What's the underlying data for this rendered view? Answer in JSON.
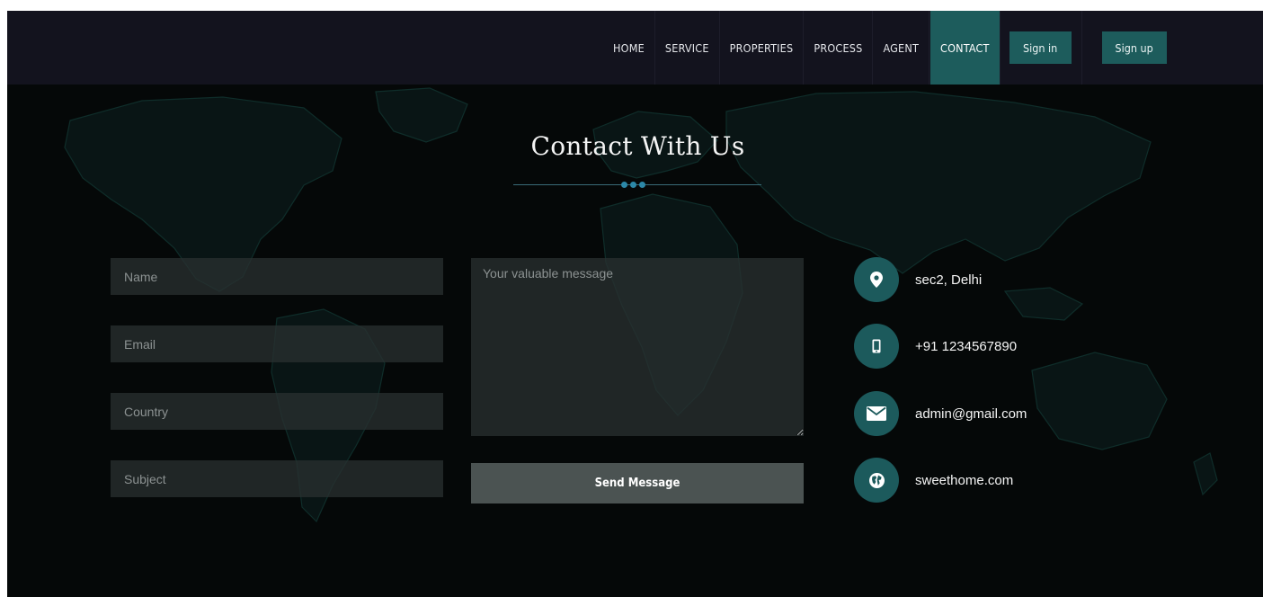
{
  "nav": {
    "items": [
      {
        "label": "HOME"
      },
      {
        "label": "SERVICE"
      },
      {
        "label": "PROPERTIES"
      },
      {
        "label": "PROCESS"
      },
      {
        "label": "AGENT"
      },
      {
        "label": "CONTACT",
        "active": true
      }
    ],
    "signin_label": "Sign in",
    "signup_label": "Sign up"
  },
  "section": {
    "title": "Contact With Us"
  },
  "form": {
    "name_placeholder": "Name",
    "email_placeholder": "Email",
    "country_placeholder": "Country",
    "subject_placeholder": "Subject",
    "message_placeholder": "Your valuable message",
    "send_label": "Send Message"
  },
  "contact": {
    "items": [
      {
        "icon": "map-marker-icon",
        "text": "sec2, Delhi"
      },
      {
        "icon": "mobile-phone-icon",
        "text": "+91 1234567890"
      },
      {
        "icon": "envelope-icon",
        "text": "admin@gmail.com"
      },
      {
        "icon": "globe-icon",
        "text": "sweethome.com"
      }
    ]
  },
  "colors": {
    "navbar_bg": "#13131e",
    "accent_teal": "#1d5c5c",
    "page_bg": "#050808",
    "divider_dot": "#2c88a8",
    "field_bg": "#283030",
    "send_button_bg": "#4b5352"
  }
}
